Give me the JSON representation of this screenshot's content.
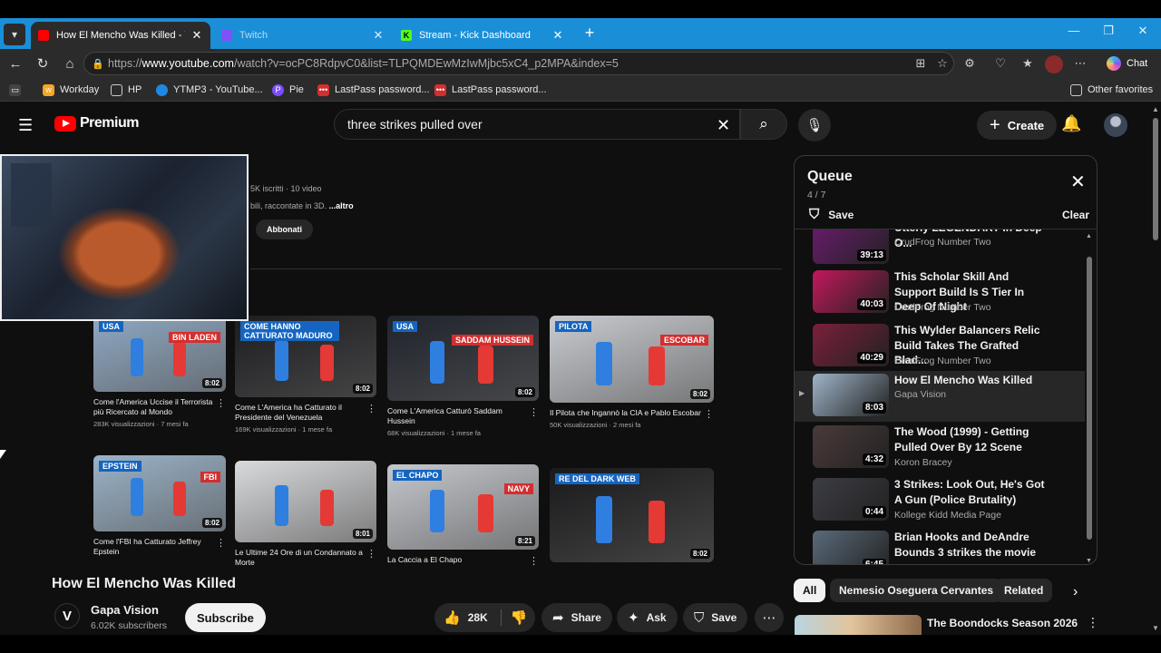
{
  "browser": {
    "tabs": [
      {
        "title": "How El Mencho Was Killed - YouTube",
        "active": true,
        "favicon": "youtube-icon"
      },
      {
        "title": "Twitch",
        "active": false,
        "favicon": "twitch-icon"
      },
      {
        "title": "Stream - Kick Dashboard",
        "active": false,
        "favicon": "kick-icon"
      }
    ],
    "url_prefix": "https://",
    "url_host": "www.youtube.com",
    "url_path": "/watch?v=ocPC8RdpvC0&list=TLPQMDEwMzIwMjbc5xC4_p2MPA&index=5",
    "chat_label": "Chat",
    "bookmarks": [
      {
        "label": "Workday",
        "icon": "workday-icon",
        "color": "#f5a623"
      },
      {
        "label": "HP",
        "icon": "folder-icon",
        "color": "#888888"
      },
      {
        "label": "YTMP3 - YouTube...",
        "icon": "ytmp3-icon",
        "color": "#1e88e5"
      },
      {
        "label": "Pie",
        "icon": "pie-icon",
        "color": "#7c4dff"
      },
      {
        "label": "LastPass password...",
        "icon": "lastpass-icon",
        "color": "#d32f2f"
      },
      {
        "label": "LastPass password...",
        "icon": "lastpass-icon",
        "color": "#d32f2f"
      }
    ],
    "other_favorites": "Other favorites"
  },
  "youtube": {
    "logo_text": "Premium",
    "search_query": "three strikes pulled over",
    "create_label": "Create",
    "channel_overlay": {
      "stats": "5K iscritti · 10 video",
      "desc": "bili, raccontate in 3D.",
      "desc_more": "...altro",
      "subscribed_label": "Abbonati"
    },
    "grid_videos": [
      {
        "title": "Come l'America Uccise il Terrorista più Ricercato al Mondo",
        "meta": "283K visualizzazioni · 7 mesi fa",
        "duration": "8:02",
        "label1": "USA",
        "label2": "BIN LADEN",
        "bg": "#8fa9c4"
      },
      {
        "title": "Come L'America ha Catturato il Presidente del Venezuela",
        "meta": "169K visualizzazioni · 1 mese fa",
        "duration": "8:02",
        "label1": "COME HANNO CATTURATO MADURO",
        "label2": "",
        "bg": "#1d1d20"
      },
      {
        "title": "Come L'America Catturò Saddam Hussein",
        "meta": "68K visualizzazioni · 1 mese fa",
        "duration": "8:02",
        "label1": "USA",
        "label2": "SADDAM HUSSEIN",
        "bg": "#20242c"
      },
      {
        "title": "Il Pilota che Ingannò la CIA e Pablo Escobar",
        "meta": "50K visualizzazioni · 2 mesi fa",
        "duration": "8:02",
        "label1": "PILOTA",
        "label2": "ESCOBAR",
        "bg": "#c8cbd0"
      },
      {
        "title": "Come l'FBI ha Catturato Jeffrey Epstein",
        "meta": "",
        "duration": "8:02",
        "label1": "EPSTEIN",
        "label2": "FBI",
        "bg": "#9ab3c9"
      },
      {
        "title": "Le Ultime 24 Ore di un Condannato a Morte",
        "meta": "",
        "duration": "8:01",
        "label1": "",
        "label2": "",
        "bg": "#d9dadc"
      },
      {
        "title": "La Caccia a El Chapo",
        "meta": "",
        "duration": "8:21",
        "label1": "EL CHAPO",
        "label2": "NAVY",
        "bg": "#c4c7cc"
      },
      {
        "title": "",
        "meta": "",
        "duration": "8:02",
        "label1": "RE DEL DARK WEB",
        "label2": "",
        "bg": "#1a1a1c"
      }
    ],
    "video": {
      "title": "How El Mencho Was Killed",
      "channel_initial": "V",
      "channel": "Gapa Vision",
      "subscribers": "6.02K subscribers",
      "subscribe_label": "Subscribe",
      "likes": "28K",
      "share_label": "Share",
      "ask_label": "Ask",
      "save_label": "Save"
    },
    "queue": {
      "title": "Queue",
      "position": "4 / 7",
      "save_label": "Save",
      "clear_label": "Clear",
      "items": [
        {
          "title": "Utterly LEGENDARY In Deep O...",
          "channel": "CrudFrog Number Two",
          "duration": "39:13",
          "current": false,
          "thumb": "#6a1b6e"
        },
        {
          "title": "This Scholar Skill And Support Build Is S Tier In Deep Of Night",
          "channel": "CrudFrog Number Two",
          "duration": "40:03",
          "current": false,
          "thumb": "#c2185b"
        },
        {
          "title": "This Wylder Balancers Relic Build Takes The Grafted Blad...",
          "channel": "CrudFrog Number Two",
          "duration": "40:29",
          "current": false,
          "thumb": "#7b1f3a"
        },
        {
          "title": "How El Mencho Was Killed",
          "channel": "Gapa Vision",
          "duration": "8:03",
          "current": true,
          "thumb": "#9fb4c8"
        },
        {
          "title": "The Wood (1999) - Getting Pulled Over By 12 Scene",
          "channel": "Koron Bracey",
          "duration": "4:32",
          "current": false,
          "thumb": "#4a3a3a"
        },
        {
          "title": "3 Strikes: Look Out, He's Got A Gun (Police Brutality)",
          "channel": "Kollege Kidd Media Page",
          "duration": "0:44",
          "current": false,
          "thumb": "#3c3c44"
        },
        {
          "title": "Brian Hooks and DeAndre Bounds 3 strikes the movie",
          "channel": "",
          "duration": "6:45",
          "current": false,
          "thumb": "#5a6a7a"
        }
      ]
    },
    "chips": [
      "All",
      "Nemesio Oseguera Cervantes",
      "Related"
    ],
    "related_title": "The Boondocks Season 2026"
  }
}
